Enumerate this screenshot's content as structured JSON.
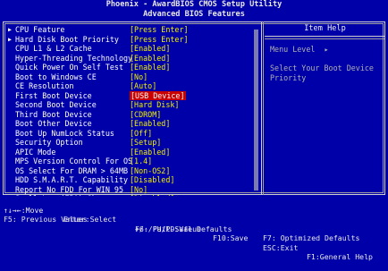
{
  "header": {
    "title_line1": "Phoenix - AwardBIOS CMOS Setup Utility",
    "title_line2": "Advanced BIOS Features"
  },
  "settings": [
    {
      "arrow": true,
      "label": "CPU Feature",
      "value": "[Press Enter]",
      "highlight": false
    },
    {
      "arrow": true,
      "label": "Hard Disk Boot Priority",
      "value": "[Press Enter]",
      "highlight": false
    },
    {
      "arrow": false,
      "label": "CPU L1 & L2 Cache",
      "value": "[Enabled]",
      "highlight": false
    },
    {
      "arrow": false,
      "label": "Hyper-Threading Technology",
      "value": "[Enabled]",
      "highlight": false
    },
    {
      "arrow": false,
      "label": "Quick Power On Self Test",
      "value": "[Enabled]",
      "highlight": false
    },
    {
      "arrow": false,
      "label": "Boot to Windows CE",
      "value": "[No]",
      "highlight": false
    },
    {
      "arrow": false,
      "label": "CE Resolution",
      "value": "[Auto]",
      "highlight": false
    },
    {
      "arrow": false,
      "label": "First Boot Device",
      "value": "[USB Device]",
      "highlight": true
    },
    {
      "arrow": false,
      "label": "Second Boot Device",
      "value": "[Hard Disk]",
      "highlight": false
    },
    {
      "arrow": false,
      "label": "Third Boot Device",
      "value": "[CDROM]",
      "highlight": false
    },
    {
      "arrow": false,
      "label": "Boot Other Device",
      "value": "[Enabled]",
      "highlight": false
    },
    {
      "arrow": false,
      "label": "Boot Up NumLock Status",
      "value": "[Off]",
      "highlight": false
    },
    {
      "arrow": false,
      "label": "Security Option",
      "value": "[Setup]",
      "highlight": false
    },
    {
      "arrow": false,
      "label": "APIC Mode",
      "value": "[Enabled]",
      "highlight": false
    },
    {
      "arrow": false,
      "label": "MPS Version Control For OS",
      "value": "[1.4]",
      "highlight": false
    },
    {
      "arrow": false,
      "label": "OS Select For DRAM > 64MB",
      "value": "[Non-OS2]",
      "highlight": false
    },
    {
      "arrow": false,
      "label": "HDD S.M.A.R.T. Capability",
      "value": "[Disabled]",
      "highlight": false
    },
    {
      "arrow": false,
      "label": "Report No FDD For WIN 95",
      "value": "[No]",
      "highlight": false
    },
    {
      "arrow": false,
      "label": "Small Logo(EPA) Show",
      "value": "[Disabled]",
      "highlight": false
    }
  ],
  "help": {
    "title": "Item Help",
    "menu_level": "Menu Level  ▸",
    "description": "Select Your Boot Device Priority"
  },
  "footer": {
    "row1": [
      {
        "key": "↑↓→←:Move",
        "text": "Enter:Select"
      },
      {
        "key": "+/-/PU/PD:Value",
        "text": "F10:Save"
      },
      {
        "key": "ESC:Exit",
        "text": "F1:General Help"
      }
    ],
    "row2": [
      {
        "text": "F5: Previous Values"
      },
      {
        "text": "F6: Fail-Safe Defaults"
      },
      {
        "text": "F7: Optimized Defaults"
      }
    ]
  },
  "colors": {
    "background": "#0000a8",
    "value_text": "#f0f000",
    "selected_bg": "#c80000",
    "help_text": "#b0b0b0"
  }
}
